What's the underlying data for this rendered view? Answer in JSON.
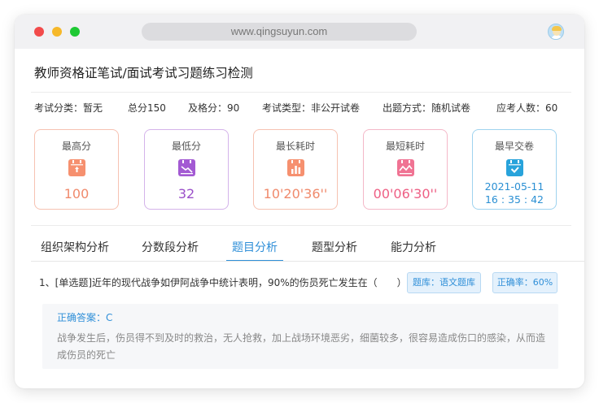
{
  "browser": {
    "url": "www.qingsuyun.com"
  },
  "page": {
    "title": "教师资格证笔试/面试考试习题练习检测"
  },
  "info": {
    "category": "考试分类：暂无",
    "total": "总分150",
    "pass": "及格分：90",
    "type": "考试类型：非公开试卷",
    "mode": "出题方式：随机试卷",
    "count": "应考人数：60"
  },
  "cards": [
    {
      "label": "最高分",
      "value": "100",
      "color": "#f08a6c",
      "icon": "trophy-calendar-icon"
    },
    {
      "label": "最低分",
      "value": "32",
      "color": "#9a4fc9",
      "icon": "trend-down-icon"
    },
    {
      "label": "最长耗时",
      "value": "10'20'36''",
      "color": "#f08a6c",
      "icon": "bar-chart-icon"
    },
    {
      "label": "最短耗时",
      "value": "00'06'30''",
      "color": "#ee5f84",
      "icon": "line-chart-icon"
    },
    {
      "label": "最早交卷",
      "value_date": "2021-05-11",
      "value_time": "16 : 35 : 42",
      "color": "#2a8fd3",
      "icon": "check-calendar-icon"
    }
  ],
  "tabs": [
    "组织架构分析",
    "分数段分析",
    "题目分析",
    "题型分析",
    "能力分析"
  ],
  "active_tab": "题目分析",
  "question": {
    "text": "1、[单选题]近年的现代战争如伊阿战争中统计表明，90%的伤员死亡发生在（　　）",
    "bank": "题库：语文题库",
    "rate": "正确率：60%",
    "answer_label": "正确答案：C",
    "explanation": "战争发生后，伤员得不到及时的救治，无人抢救，加上战场环境恶劣，细菌较多，很容易造成伤口的感染，从而造成伤员的死亡"
  }
}
